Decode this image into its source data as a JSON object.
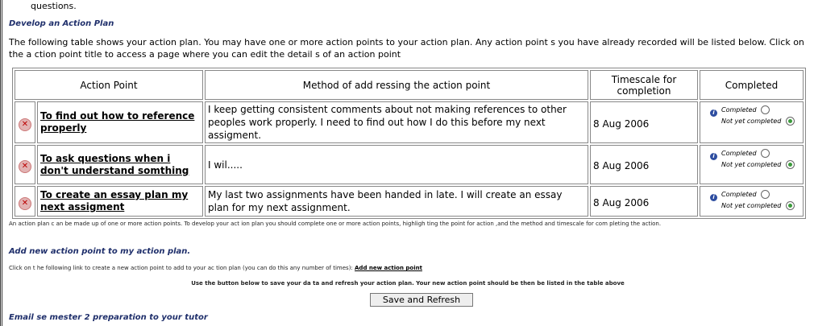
{
  "top_fragment": "questions.",
  "develop": {
    "heading": "Develop an Action Plan",
    "intro": "The following table shows your action plan. You may have one or more action points to your action plan. Any action point s you have already recorded will be listed below. Click on the a ction point title to access a page where you can edit the detail s of an action point"
  },
  "table": {
    "headers": {
      "action_point": "Action Point",
      "method": "Method of add ressing the action point",
      "timescale": "Timescale for completion",
      "completed": "Completed"
    },
    "rows": [
      {
        "title": "To find out how to reference properly",
        "method": "I keep getting consistent comments about not making references to other peoples work properly. I need to find out how I do this before my next assigment.",
        "timescale": "8 Aug 2006",
        "opt_completed": "Completed",
        "opt_not_completed": "Not yet completed",
        "status": "not_yet_completed"
      },
      {
        "title": "To ask questions when i don't understand somthing",
        "method": "I wil.....",
        "timescale": "8 Aug 2006",
        "opt_completed": "Completed",
        "opt_not_completed": "Not yet completed",
        "status": "not_yet_completed"
      },
      {
        "title": "To create an essay plan my next assigment",
        "method": "My last two assignments have been handed in late. I will create an essay plan for my next assignment.",
        "timescale": "8 Aug 2006",
        "opt_completed": "Completed",
        "opt_not_completed": "Not yet completed",
        "status": "not_yet_completed"
      }
    ]
  },
  "note": "An action plan c an be made up of one or more action points. To develop your act ion plan you should complete one or more action points, highligh ting the point for action ,and the method and timescale for com pleting the action.",
  "add_section": {
    "heading": "Add new action point to my action plan.",
    "instruction": "Click on t he following link to create a new action point to add to your ac tion plan (you can do this any number of times):",
    "link": "Add new action point"
  },
  "save": {
    "note": "Use the button below to save your da ta and refresh your action plan. Your new action point should be then be listed in the table above",
    "button": "Save and Refresh"
  },
  "email_heading": "Email se mester 2 preparation to your tutor"
}
